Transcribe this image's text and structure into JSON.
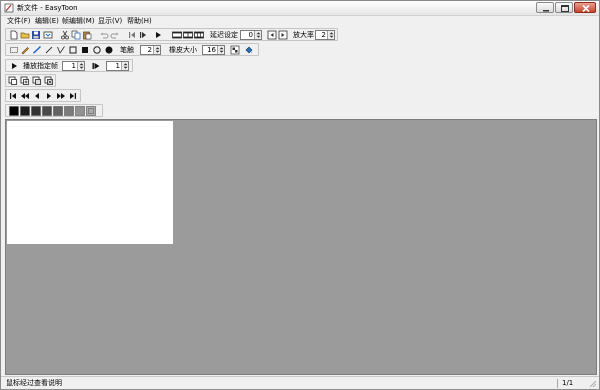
{
  "window": {
    "title": "新文件 - EasyToon"
  },
  "menu": [
    "文件(F)",
    "编辑(E)",
    "帧编辑(M)",
    "显示(V)",
    "帮助(H)"
  ],
  "toolbar1": {
    "delay_label": "延迟设定",
    "delay_value": "0",
    "zoom_label": "放大率",
    "zoom_value": "2"
  },
  "toolbar2": {
    "pen_label": "笔触",
    "pen_value": "2",
    "eraser_label": "橡皮大小",
    "eraser_value": "16"
  },
  "toolbar3": {
    "playrange_label": "播放指定帧",
    "start_value": "1",
    "end_value": "1"
  },
  "status": {
    "hint": "鼠标经过查看说明",
    "page": "1/1"
  },
  "colors": {
    "canvas": "#ffffff",
    "workspace": "#9b9b9b"
  }
}
